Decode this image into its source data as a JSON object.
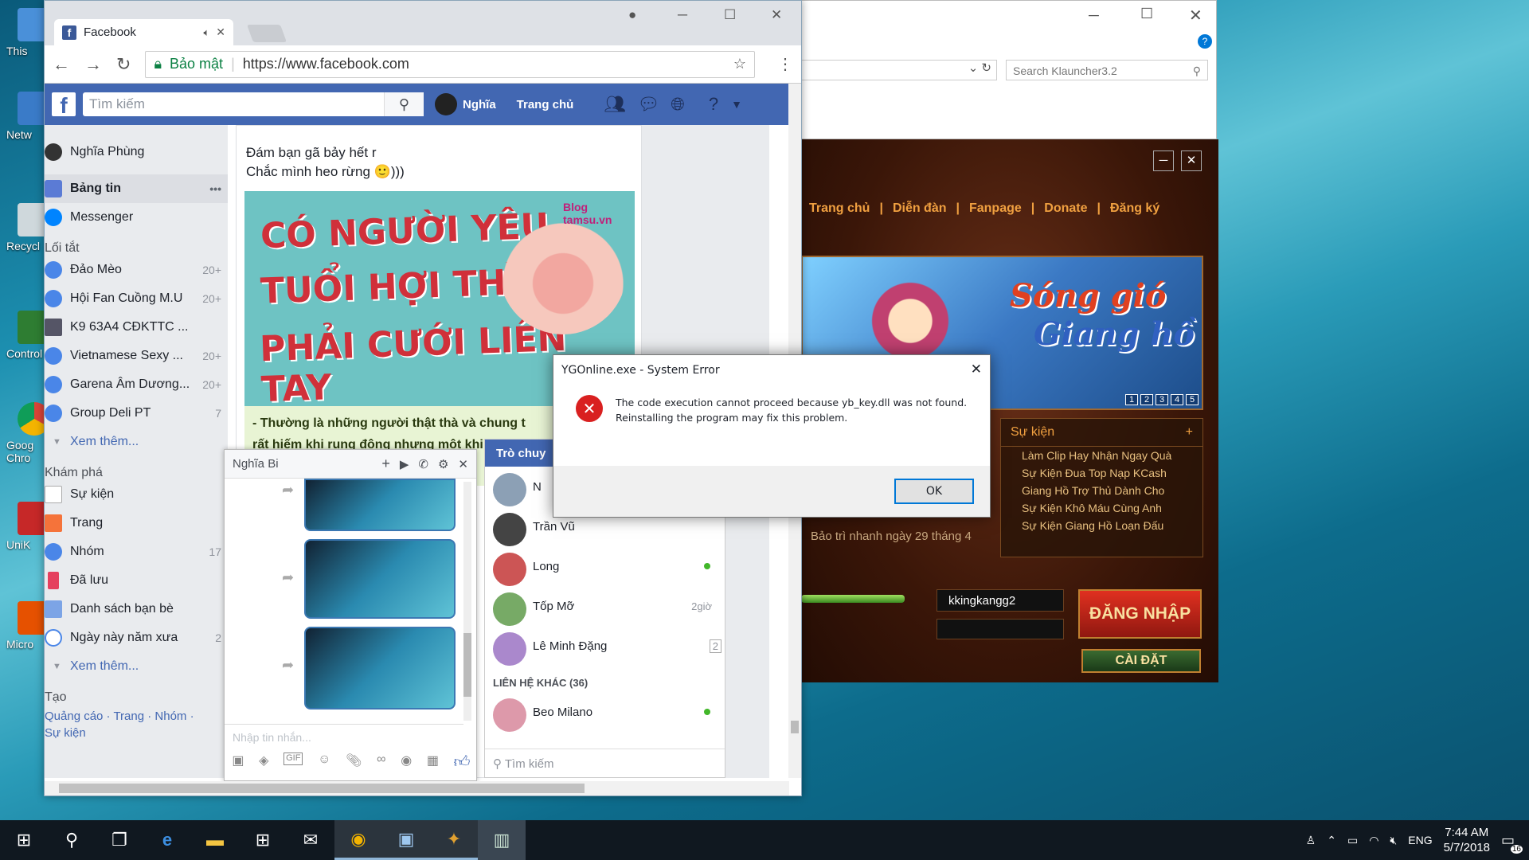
{
  "desktop": {
    "icons": [
      "This",
      "Netw",
      "Recycl",
      "Control",
      "Goog\nChro",
      "UniK",
      "Micro"
    ]
  },
  "chrome": {
    "tab_title": "Facebook",
    "secure_label": "Bảo mật",
    "url": "https://www.facebook.com"
  },
  "fb": {
    "search_placeholder": "Tìm kiếm",
    "profile_name": "Nghĩa",
    "home_label": "Trang chủ",
    "left_nav": {
      "user": "Nghĩa Phùng",
      "news_feed": "Bảng tin",
      "messenger": "Messenger",
      "shortcuts_title": "Lối tắt",
      "shortcuts": [
        {
          "label": "Đảo Mèo",
          "count": "20+"
        },
        {
          "label": "Hội Fan Cuồng M.U",
          "count": "20+"
        },
        {
          "label": "K9 63A4 CĐKTTC ...",
          "count": ""
        },
        {
          "label": "Vietnamese Sexy ...",
          "count": "20+"
        },
        {
          "label": "Garena Âm Dương...",
          "count": "20+"
        },
        {
          "label": "Group Deli PT",
          "count": "7"
        }
      ],
      "see_more": "Xem thêm...",
      "explore_title": "Khám phá",
      "explore": [
        {
          "label": "Sự kiện",
          "count": ""
        },
        {
          "label": "Trang",
          "count": ""
        },
        {
          "label": "Nhóm",
          "count": "17"
        },
        {
          "label": "Đã lưu",
          "count": ""
        },
        {
          "label": "Danh sách bạn bè",
          "count": ""
        },
        {
          "label": "Ngày này năm xưa",
          "count": "2"
        }
      ],
      "see_more2": "Xem thêm...",
      "create_title": "Tạo",
      "create_links": "Quảng cáo · Trang · Nhóm ·",
      "create_links2": "Sự kiện"
    },
    "post": {
      "line1": "Đám bạn gã bảy hết r",
      "line2": "Chắc mình heo rừng 🙂)))",
      "meme_l1": "CÓ NGƯỜI YÊU",
      "meme_l2": "TUỔI HỢI THÌ",
      "meme_l3": "PHẢI CƯỚI LIỀN TAY",
      "meme_brand": "Blog tamsu.vn",
      "caption1": "- Thường là những người thật thà và chung t",
      "caption2": "rất hiếm khi rung động nhưng một khi ..."
    },
    "chat": {
      "name": "Nghĩa Bi",
      "input_placeholder": "Nhập tin nhắn..."
    },
    "contacts": {
      "header": "Trò chuy",
      "list": [
        {
          "name": "N",
          "time": ""
        },
        {
          "name": "Trần Vũ",
          "time": ""
        },
        {
          "name": "Long",
          "time": ""
        },
        {
          "name": "Tốp Mỡ",
          "time": "2giờ"
        },
        {
          "name": "Lê Minh Đặng",
          "time": "2"
        }
      ],
      "other_header": "LIÊN HỆ KHÁC (36)",
      "other": [
        {
          "name": "Beo Milano"
        }
      ],
      "search_placeholder": "Tìm kiếm"
    }
  },
  "launcher": {
    "search_placeholder": "Search Klauncher3.2",
    "nav": [
      "Trang chủ",
      "Diễn đàn",
      "Fanpage",
      "Donate",
      "Đăng ký"
    ],
    "banner_title_1": "Sóng gió",
    "banner_title_2": "Giang hồ",
    "banner_pages": [
      "1",
      "2",
      "3",
      "4",
      "5"
    ],
    "events_title": "Sự kiện",
    "events": [
      "Làm Clip Hay Nhận Ngay Quà",
      "Sự Kiện Đua Top Nạp KCash",
      "Giang Hồ Trợ Thủ Dành Cho",
      "Sự Kiện Khô Máu Cùng Anh",
      "Sự Kiện Giang Hồ Loạn Đấu"
    ],
    "notice": "Bảo trì nhanh ngày 29 tháng 4",
    "username": "kkingkangg2",
    "login_button": "ĐĂNG NHẬP",
    "settings_button": "CÀI ĐẶT"
  },
  "error_dialog": {
    "title": "YGOnline.exe - System Error",
    "message1": "The code execution cannot proceed because yb_key.dll was not found.",
    "message2": "Reinstalling the program may fix this problem.",
    "ok_label": "OK"
  },
  "taskbar": {
    "language": "ENG",
    "time": "7:44 AM",
    "date": "5/7/2018",
    "notifications": "16"
  }
}
